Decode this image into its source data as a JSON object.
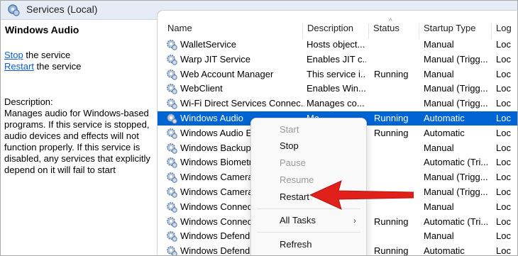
{
  "window": {
    "title": "Services (Local)"
  },
  "left_pane": {
    "service_name": "Windows Audio",
    "actions": [
      {
        "link": "Stop",
        "suffix": " the service"
      },
      {
        "link": "Restart",
        "suffix": " the service"
      }
    ],
    "description_label": "Description:",
    "description": "Manages audio for Windows-based programs.  If this service is stopped, audio devices and effects will not function properly.  If this service is disabled, any services that explicitly depend on it will fail to start"
  },
  "table": {
    "sort_indicator": "^",
    "columns": [
      "Name",
      "Description",
      "Status",
      "Startup Type",
      "Log"
    ],
    "rows": [
      {
        "name": "WalletService",
        "description": "Hosts object...",
        "status": "",
        "startup": "Manual",
        "log": "Loc"
      },
      {
        "name": "Warp JIT Service",
        "description": "Enables JIT c...",
        "status": "",
        "startup": "Manual (Trigg...",
        "log": "Loc"
      },
      {
        "name": "Web Account Manager",
        "description": "This service i...",
        "status": "Running",
        "startup": "Manual",
        "log": "Loc"
      },
      {
        "name": "WebClient",
        "description": "Enables Win...",
        "status": "",
        "startup": "Manual (Trigg...",
        "log": "Loc"
      },
      {
        "name": "Wi-Fi Direct Services Connec...",
        "description": "Manages co...",
        "status": "",
        "startup": "Manual (Trigg...",
        "log": "Loc"
      },
      {
        "name": "Windows Audio",
        "description": "Ma",
        "status": "Running",
        "startup": "Automatic",
        "log": "Loc",
        "selected": true
      },
      {
        "name": "Windows Audio E",
        "description": "",
        "status": "Running",
        "startup": "Automatic",
        "log": "Loc"
      },
      {
        "name": "Windows Backup",
        "description": "",
        "status": "",
        "startup": "Manual",
        "log": "Loc"
      },
      {
        "name": "Windows Biometr",
        "description": "",
        "status": "",
        "startup": "Automatic (Tri...",
        "log": "Loc"
      },
      {
        "name": "Windows Camera",
        "description": "",
        "status": "",
        "startup": "Manual (Trigg...",
        "log": "Loc"
      },
      {
        "name": "Windows Camera",
        "description": "",
        "status": "",
        "startup": "Manual (Trigg...",
        "log": "Loc"
      },
      {
        "name": "Windows Connec",
        "description": "",
        "status": "",
        "startup": "Manual",
        "log": "Loc"
      },
      {
        "name": "Windows Connec",
        "description": "",
        "status": "Running",
        "startup": "Automatic (Tri...",
        "log": "Loc"
      },
      {
        "name": "Windows Defend",
        "description": "",
        "status": "",
        "startup": "Manual",
        "log": "Loc"
      },
      {
        "name": "Windows Defend",
        "description": "",
        "status": "Running",
        "startup": "Automatic",
        "log": "Loc"
      }
    ]
  },
  "context_menu": {
    "items": [
      {
        "label": "Start",
        "enabled": false
      },
      {
        "label": "Stop",
        "enabled": true
      },
      {
        "label": "Pause",
        "enabled": false
      },
      {
        "label": "Resume",
        "enabled": false
      },
      {
        "label": "Restart",
        "enabled": true
      },
      {
        "label": "All Tasks",
        "enabled": true,
        "submenu": true
      },
      {
        "label": "Refresh",
        "enabled": true
      }
    ],
    "submenu_glyph": "›"
  },
  "annotation": {
    "arrow_color": "#e0201b",
    "points_to": "Restart"
  },
  "colors": {
    "selection": "#0064d4",
    "link": "#0b5dd7"
  }
}
